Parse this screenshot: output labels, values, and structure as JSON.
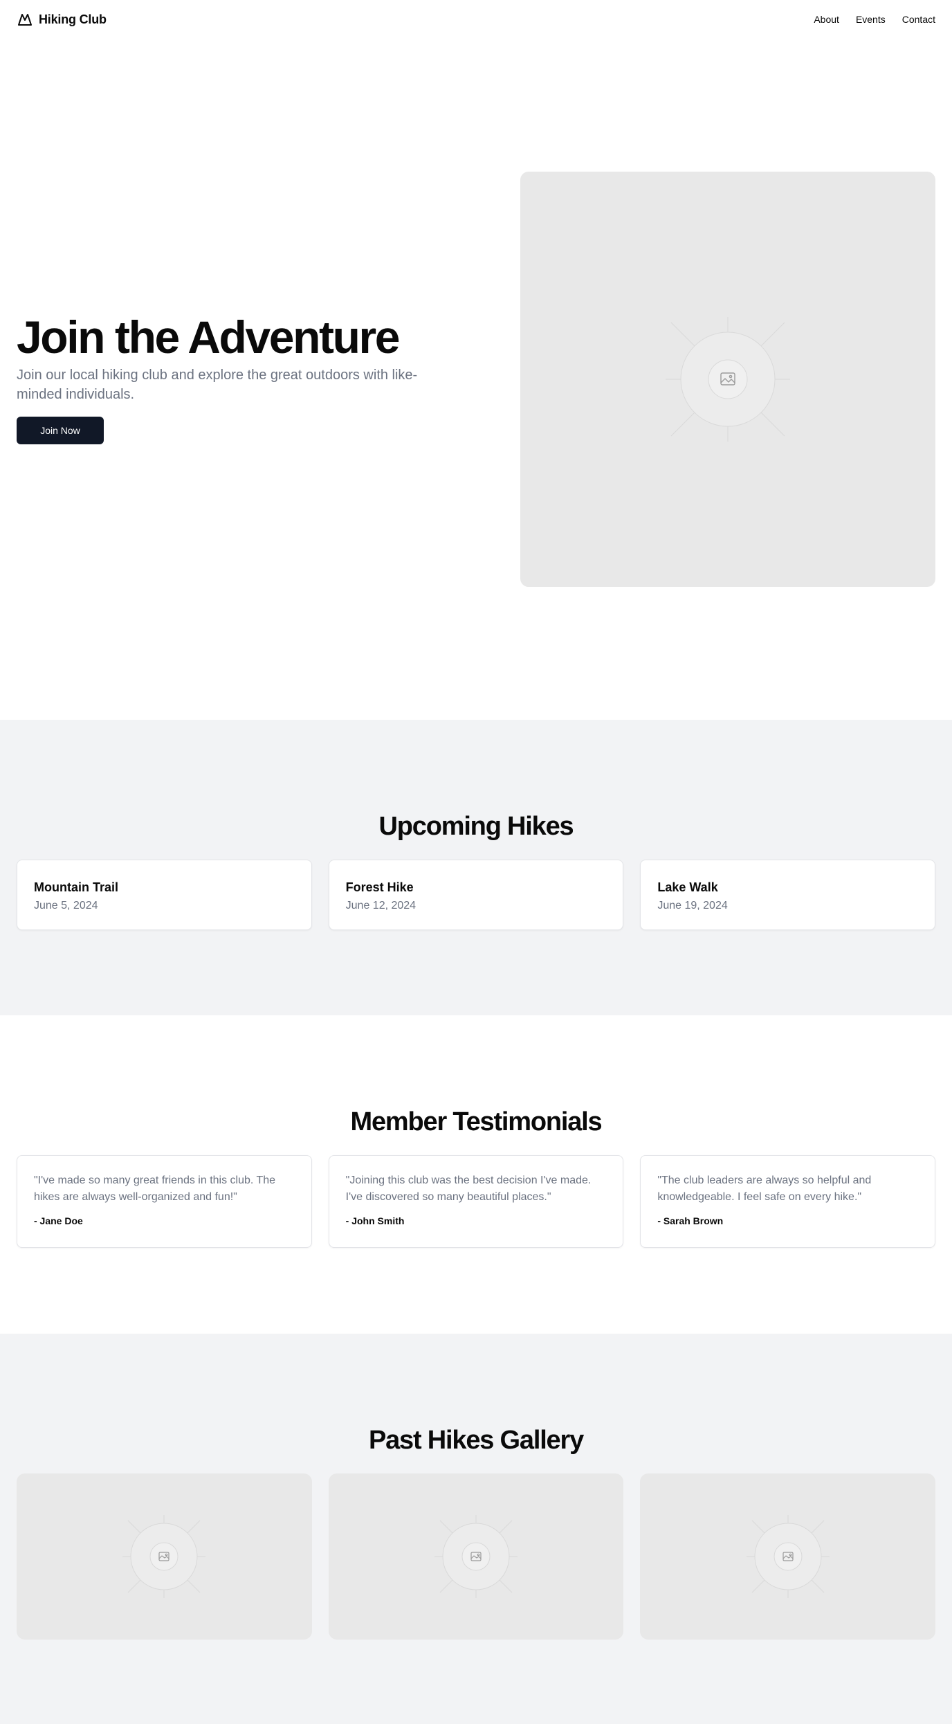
{
  "header": {
    "brand": "Hiking Club",
    "nav": [
      {
        "label": "About"
      },
      {
        "label": "Events"
      },
      {
        "label": "Contact"
      }
    ]
  },
  "hero": {
    "title": "Join the Adventure",
    "subtitle": "Join our local hiking club and explore the great outdoors with like-minded individuals.",
    "cta": "Join Now"
  },
  "upcoming": {
    "title": "Upcoming Hikes",
    "hikes": [
      {
        "name": "Mountain Trail",
        "date": "June 5, 2024"
      },
      {
        "name": "Forest Hike",
        "date": "June 12, 2024"
      },
      {
        "name": "Lake Walk",
        "date": "June 19, 2024"
      }
    ]
  },
  "testimonials": {
    "title": "Member Testimonials",
    "items": [
      {
        "quote": "\"I've made so many great friends in this club. The hikes are always well-organized and fun!\"",
        "author": "- Jane Doe"
      },
      {
        "quote": "\"Joining this club was the best decision I've made. I've discovered so many beautiful places.\"",
        "author": "- John Smith"
      },
      {
        "quote": "\"The club leaders are always so helpful and knowledgeable. I feel safe on every hike.\"",
        "author": "- Sarah Brown"
      }
    ]
  },
  "gallery": {
    "title": "Past Hikes Gallery"
  },
  "colors": {
    "primary_button": "#111827",
    "muted_text": "#6b7280",
    "section_gray": "#f2f3f5",
    "placeholder": "#e8e8e8"
  }
}
